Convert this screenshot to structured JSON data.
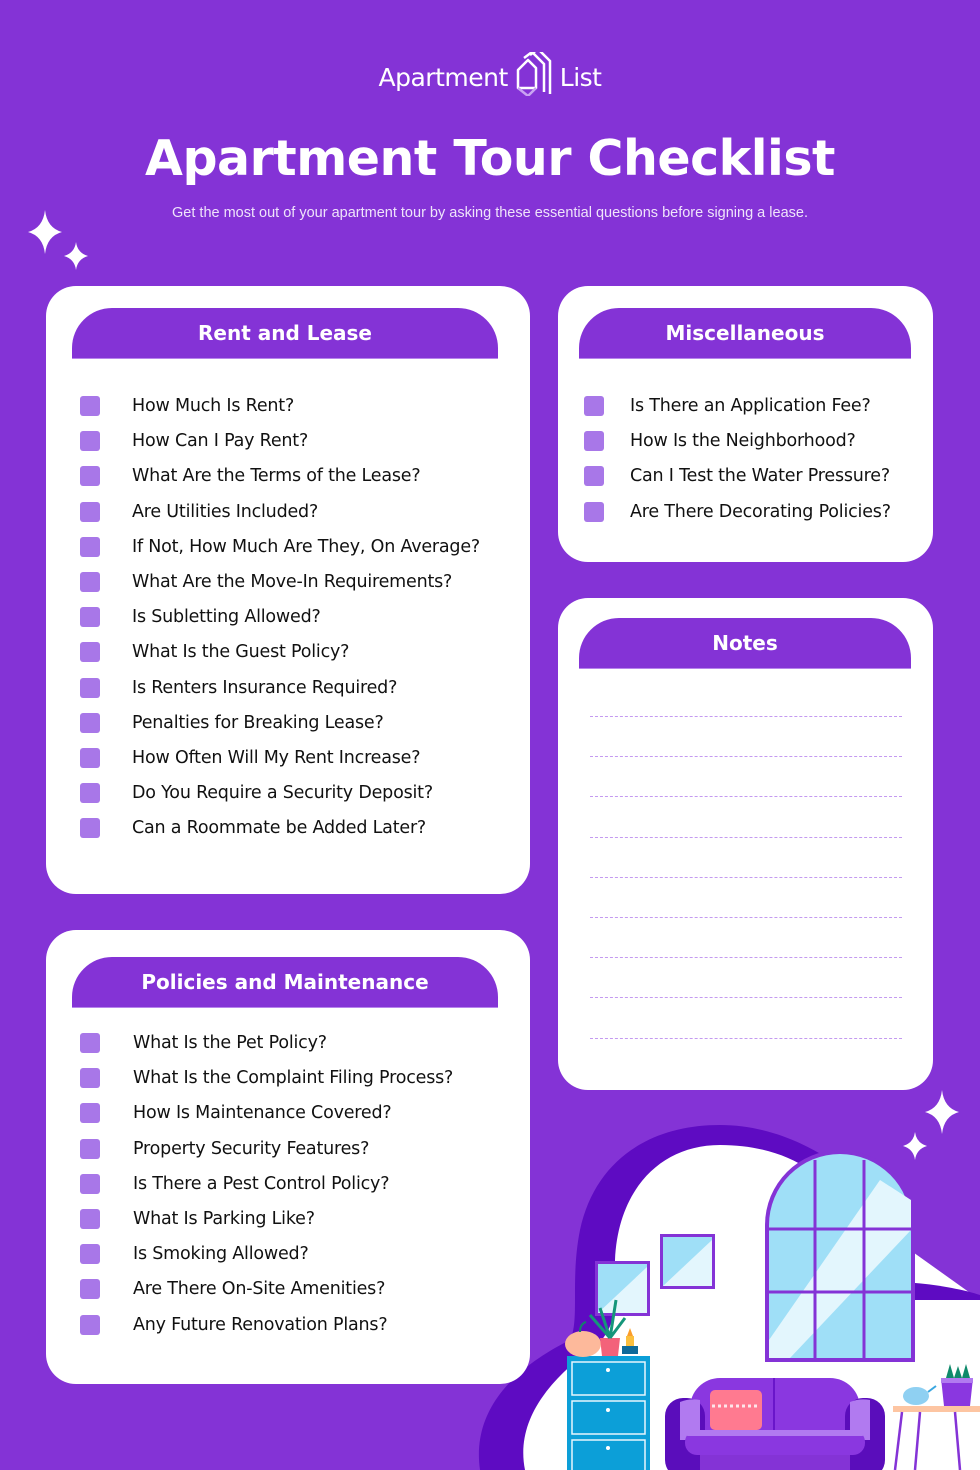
{
  "brand": {
    "name_left": "Apartment",
    "name_right": "List",
    "logo_icon": "house-lines-icon"
  },
  "header": {
    "title": "Apartment Tour Checklist",
    "subtitle": "Get the most out of your apartment tour by asking these essential questions before signing a lease."
  },
  "colors": {
    "background": "#8433d6",
    "card": "#ffffff",
    "checkbox": "#a877e8",
    "dash": "#c49af0",
    "text": "#111111"
  },
  "sections": {
    "rent_lease": {
      "title": "Rent and Lease",
      "items": [
        "How Much Is Rent?",
        "How Can I Pay Rent?",
        "What Are the Terms of the Lease?",
        "Are Utilities Included?",
        "If Not, How Much Are They, On Average?",
        "What Are the Move-In Requirements?",
        "Is Subletting Allowed?",
        "What Is the Guest Policy?",
        "Is Renters Insurance Required?",
        "Penalties for Breaking Lease?",
        "How Often Will My Rent Increase?",
        "Do You Require a Security Deposit?",
        "Can a Roommate be Added Later?"
      ]
    },
    "misc": {
      "title": "Miscellaneous",
      "items": [
        "Is There an Application Fee?",
        "How Is the Neighborhood?",
        "Can I Test the Water Pressure?",
        "Are There Decorating Policies?"
      ]
    },
    "notes": {
      "title": "Notes",
      "line_count": 9
    },
    "policies": {
      "title": "Policies and Maintenance",
      "items": [
        "What Is the Pet Policy?",
        "What Is the Complaint Filing Process?",
        "How Is Maintenance Covered?",
        "Property Security Features?",
        "Is There a Pest Control Policy?",
        "What Is Parking Like?",
        "Is Smoking Allowed?",
        "Are There On-Site Amenities?",
        "Any Future Renovation Plans?"
      ]
    }
  }
}
